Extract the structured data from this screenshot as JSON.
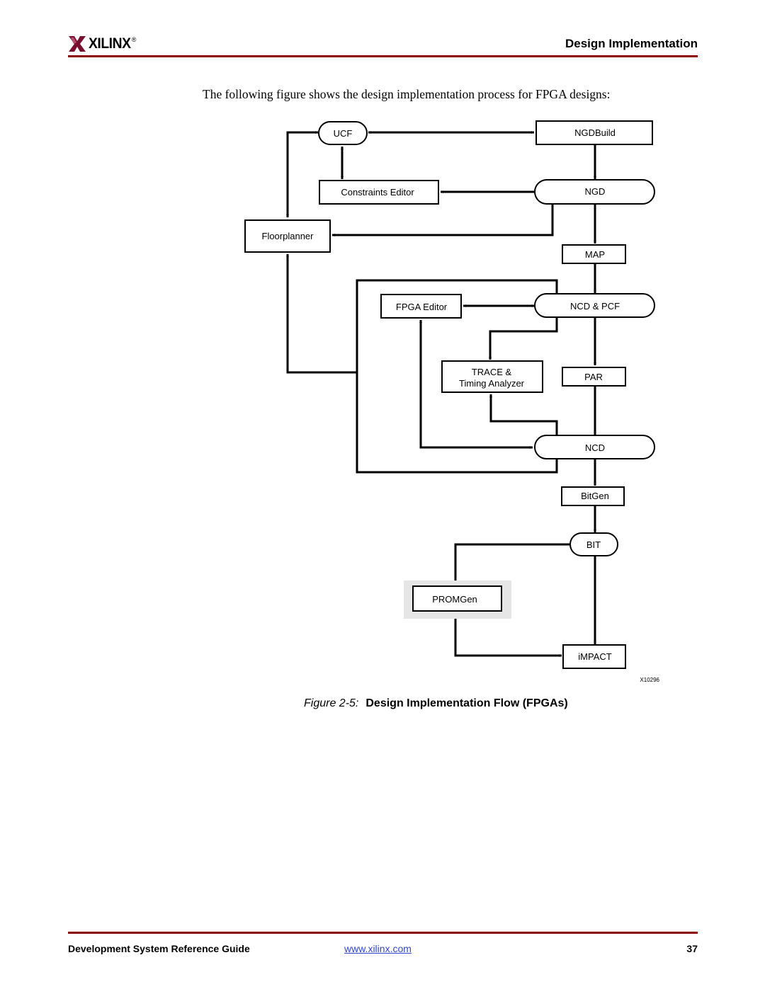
{
  "header": {
    "logo_text": "XILINX",
    "logo_registered": "®",
    "section_title": "Design Implementation",
    "brand_color": "#8b0000"
  },
  "body": {
    "intro_text": "The following figure shows the design implementation process for FPGA designs:"
  },
  "diagram": {
    "nodes": {
      "ucf": "UCF",
      "ngdbuild": "NGDBuild",
      "constraints_editor": "Constraints Editor",
      "ngd": "NGD",
      "floorplanner": "Floorplanner",
      "map": "MAP",
      "fpga_editor": "FPGA Editor",
      "ncd_pcf": "NCD & PCF",
      "trace_line1": "TRACE &",
      "trace_line2": "Timing Analyzer",
      "par": "PAR",
      "ncd": "NCD",
      "bitgen": "BitGen",
      "bit": "BIT",
      "promgen": "PROMGen",
      "impact": "iMPACT"
    },
    "edges": [
      {
        "from": "UCF",
        "to": "NGDBuild",
        "bidirectional": true
      },
      {
        "from": "UCF",
        "to": "Constraints Editor",
        "bidirectional": true
      },
      {
        "from": "UCF",
        "to": "Floorplanner",
        "bidirectional": true
      },
      {
        "from": "NGDBuild",
        "to": "NGD"
      },
      {
        "from": "NGD",
        "to": "Constraints Editor"
      },
      {
        "from": "NGD",
        "to": "Floorplanner"
      },
      {
        "from": "NGD",
        "to": "MAP"
      },
      {
        "from": "MAP",
        "to": "NCD & PCF"
      },
      {
        "from": "NCD & PCF",
        "to": "FPGA Editor",
        "bidirectional": true
      },
      {
        "from": "NCD & PCF",
        "to": "TRACE & Timing Analyzer"
      },
      {
        "from": "NCD & PCF",
        "to": "Floorplanner"
      },
      {
        "from": "NCD & PCF",
        "to": "PAR"
      },
      {
        "from": "PAR",
        "to": "NCD"
      },
      {
        "from": "FPGA Editor",
        "to": "NCD"
      },
      {
        "from": "NCD",
        "to": "TRACE & Timing Analyzer"
      },
      {
        "from": "NCD",
        "to": "Floorplanner"
      },
      {
        "from": "NCD",
        "to": "BitGen"
      },
      {
        "from": "BitGen",
        "to": "BIT"
      },
      {
        "from": "BIT",
        "to": "PROMGen"
      },
      {
        "from": "BIT",
        "to": "iMPACT"
      },
      {
        "from": "PROMGen",
        "to": "iMPACT"
      }
    ],
    "figure_id": "X10296"
  },
  "caption": {
    "figure_number": "Figure 2-5:",
    "title": "Design Implementation Flow (FPGAs)"
  },
  "footer": {
    "guide_title": "Development System Reference Guide",
    "website": "www.xilinx.com",
    "page_number": "37"
  }
}
